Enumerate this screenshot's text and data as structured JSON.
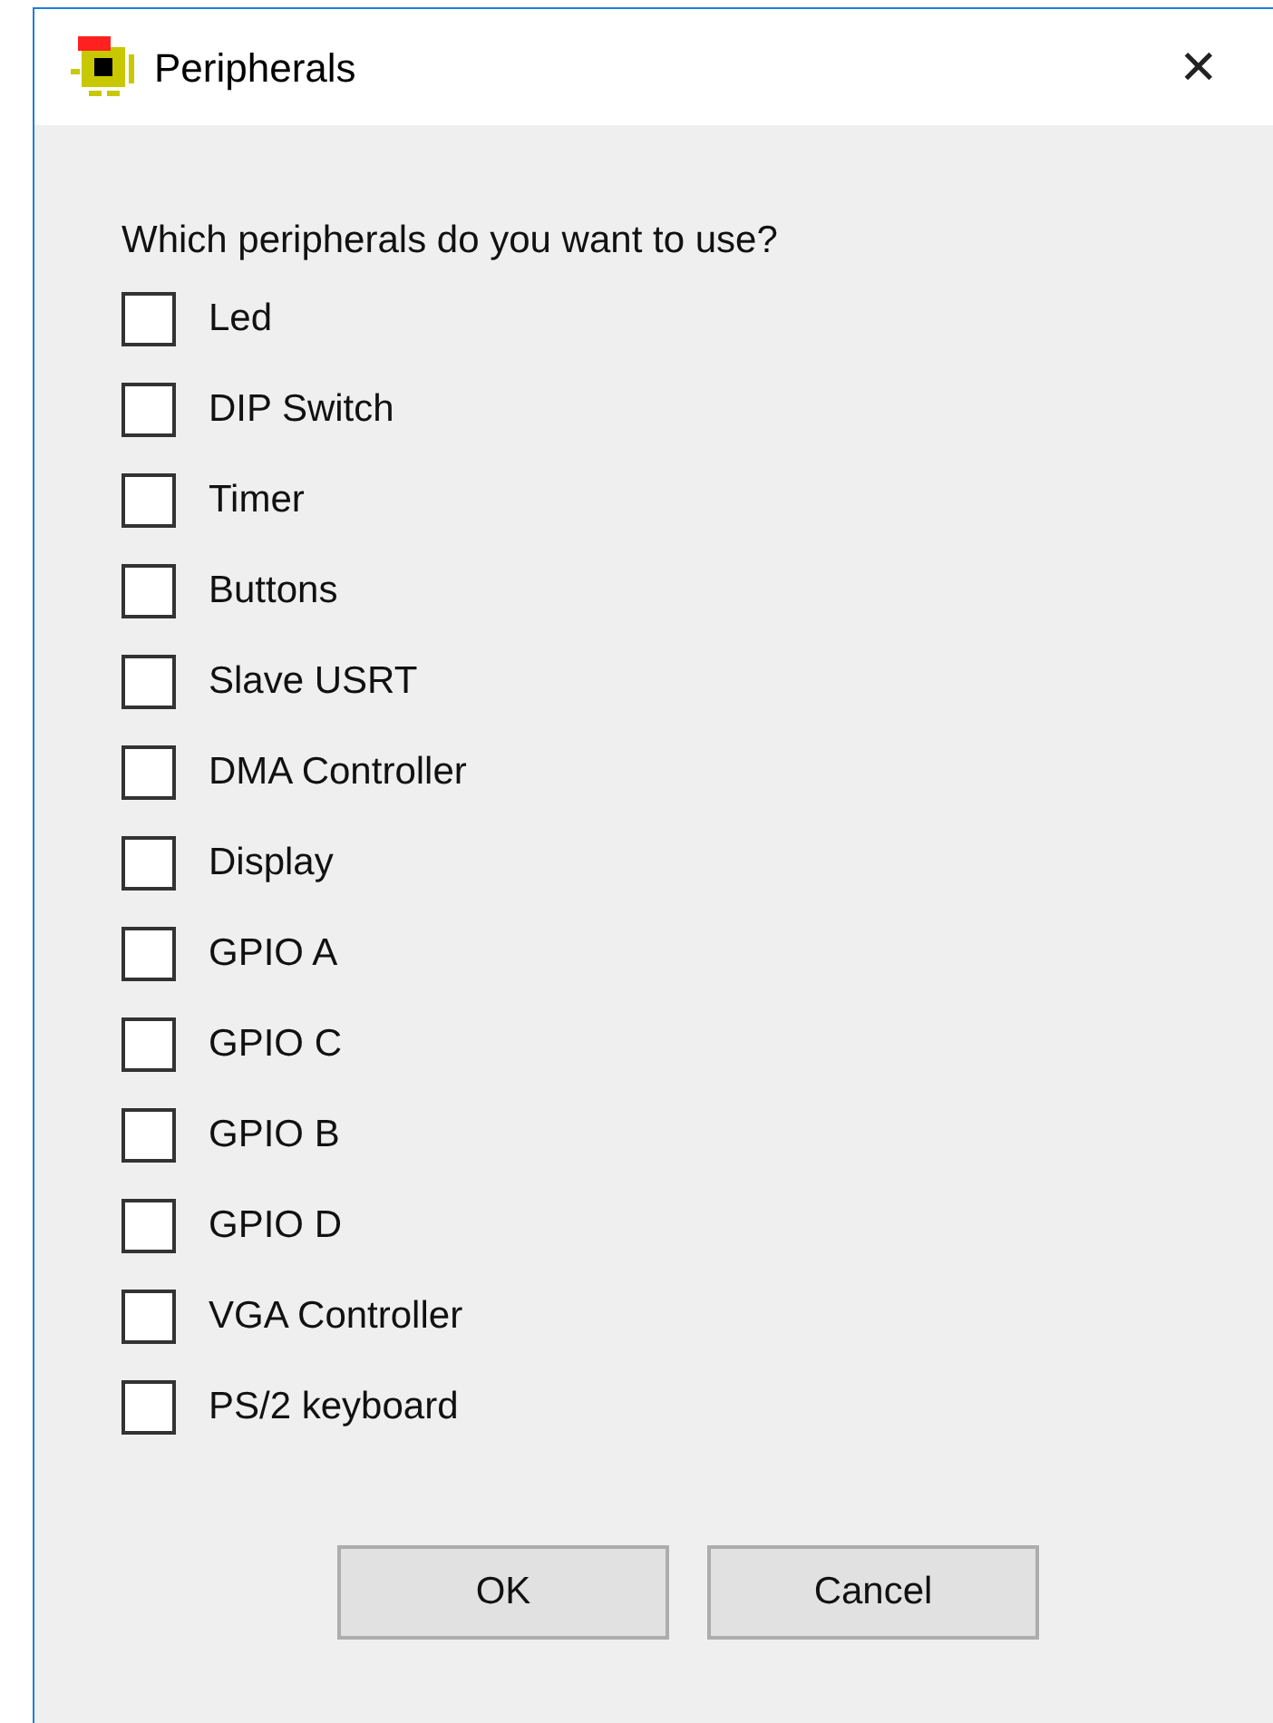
{
  "window": {
    "title": "Peripherals",
    "close": "✕"
  },
  "question": "Which peripherals do you want to use?",
  "peripherals": [
    {
      "label": "Led",
      "checked": false
    },
    {
      "label": "DIP Switch",
      "checked": false
    },
    {
      "label": "Timer",
      "checked": false
    },
    {
      "label": "Buttons",
      "checked": false
    },
    {
      "label": "Slave USRT",
      "checked": false
    },
    {
      "label": "DMA Controller",
      "checked": false
    },
    {
      "label": "Display",
      "checked": false
    },
    {
      "label": "GPIO A",
      "checked": false
    },
    {
      "label": "GPIO C",
      "checked": false
    },
    {
      "label": "GPIO B",
      "checked": false
    },
    {
      "label": "GPIO D",
      "checked": false
    },
    {
      "label": "VGA Controller",
      "checked": false
    },
    {
      "label": "PS/2 keyboard",
      "checked": false
    }
  ],
  "buttons": [
    "OK",
    "Cancel"
  ]
}
